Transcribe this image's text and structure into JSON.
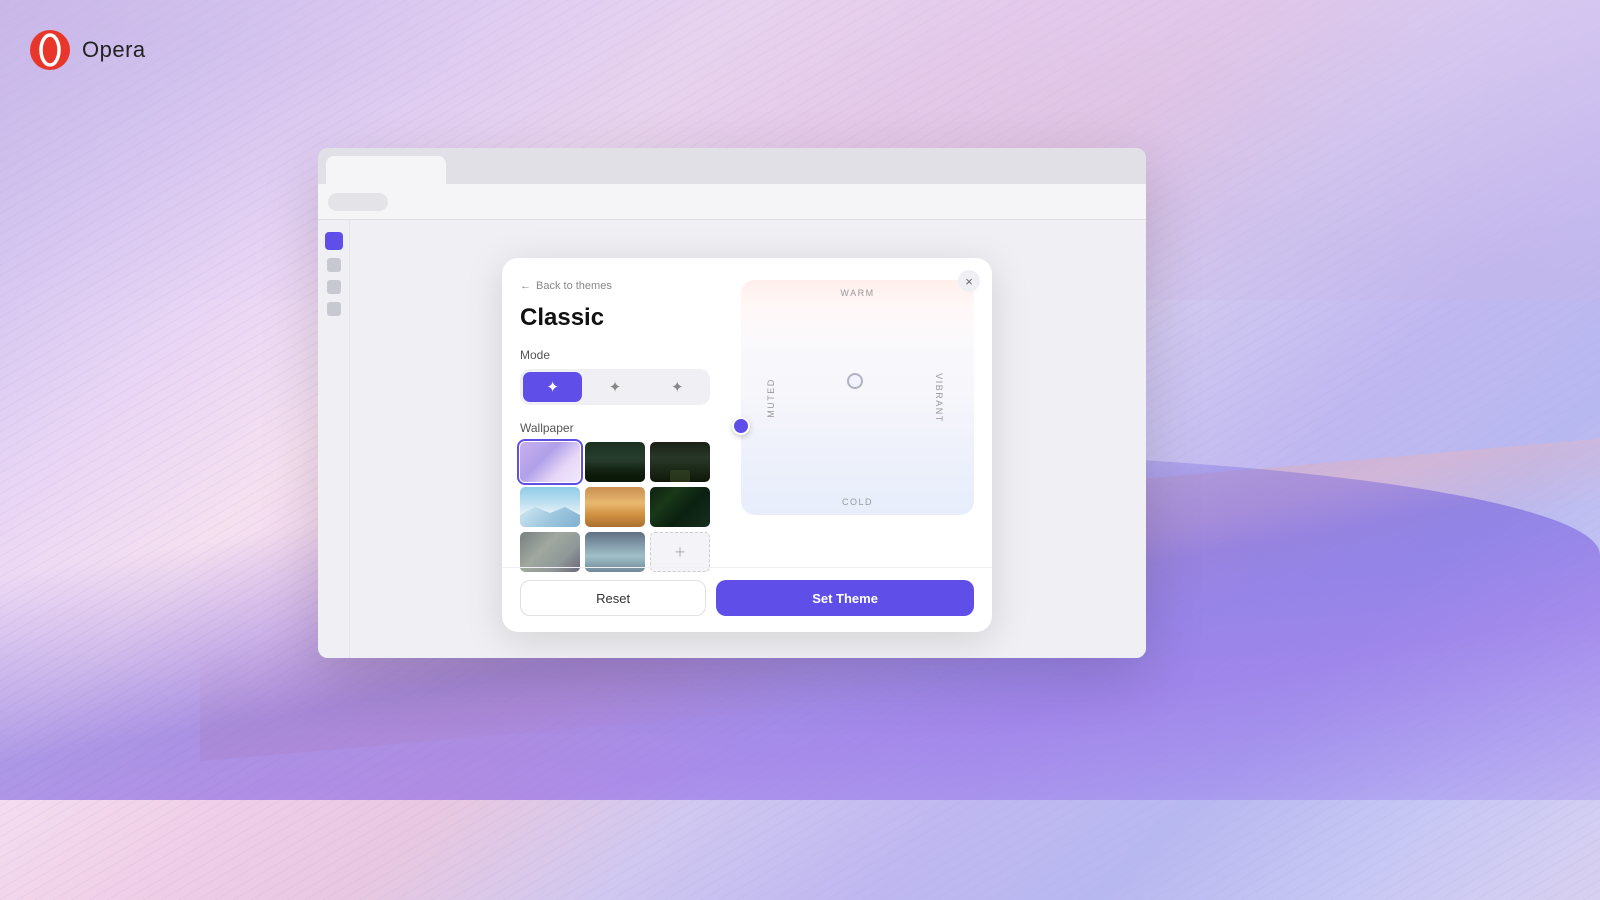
{
  "app": {
    "name": "Opera",
    "logo_text": "Opera"
  },
  "background": {
    "colors": [
      "#d0c8ec",
      "#e8d8f4",
      "#f4e0f0",
      "#c8c0f0",
      "#b0b0e8"
    ]
  },
  "browser": {
    "tab_label": ""
  },
  "dialog": {
    "back_label": "Back to themes",
    "close_label": "×",
    "title": "Classic",
    "mode_section": "Mode",
    "mode_options": [
      {
        "label": "✦",
        "value": "dark",
        "active": true
      },
      {
        "label": "✦",
        "value": "light",
        "active": false
      },
      {
        "label": "✦",
        "value": "auto",
        "active": false
      }
    ],
    "wallpaper_section": "Wallpaper",
    "wallpapers": [
      {
        "id": 1,
        "label": "Gradient purple",
        "selected": true
      },
      {
        "id": 2,
        "label": "Dark forest"
      },
      {
        "id": 3,
        "label": "Forest road"
      },
      {
        "id": 4,
        "label": "Mountains blue"
      },
      {
        "id": 5,
        "label": "Desert dunes"
      },
      {
        "id": 6,
        "label": "Dark forest 2"
      },
      {
        "id": 7,
        "label": "Rocky landscape"
      },
      {
        "id": 8,
        "label": "Lake mountains"
      },
      {
        "id": 9,
        "label": "Add custom",
        "is_add": true
      }
    ],
    "add_wallpaper_label": "+",
    "color_area": {
      "label_top": "WARM",
      "label_bottom": "COLD",
      "label_left": "MUTED",
      "label_right": "VIBRANT"
    },
    "buttons": {
      "reset": "Reset",
      "set_theme": "Set Theme"
    }
  },
  "sidebar": {
    "active_item_color": "#5f4fe8"
  }
}
